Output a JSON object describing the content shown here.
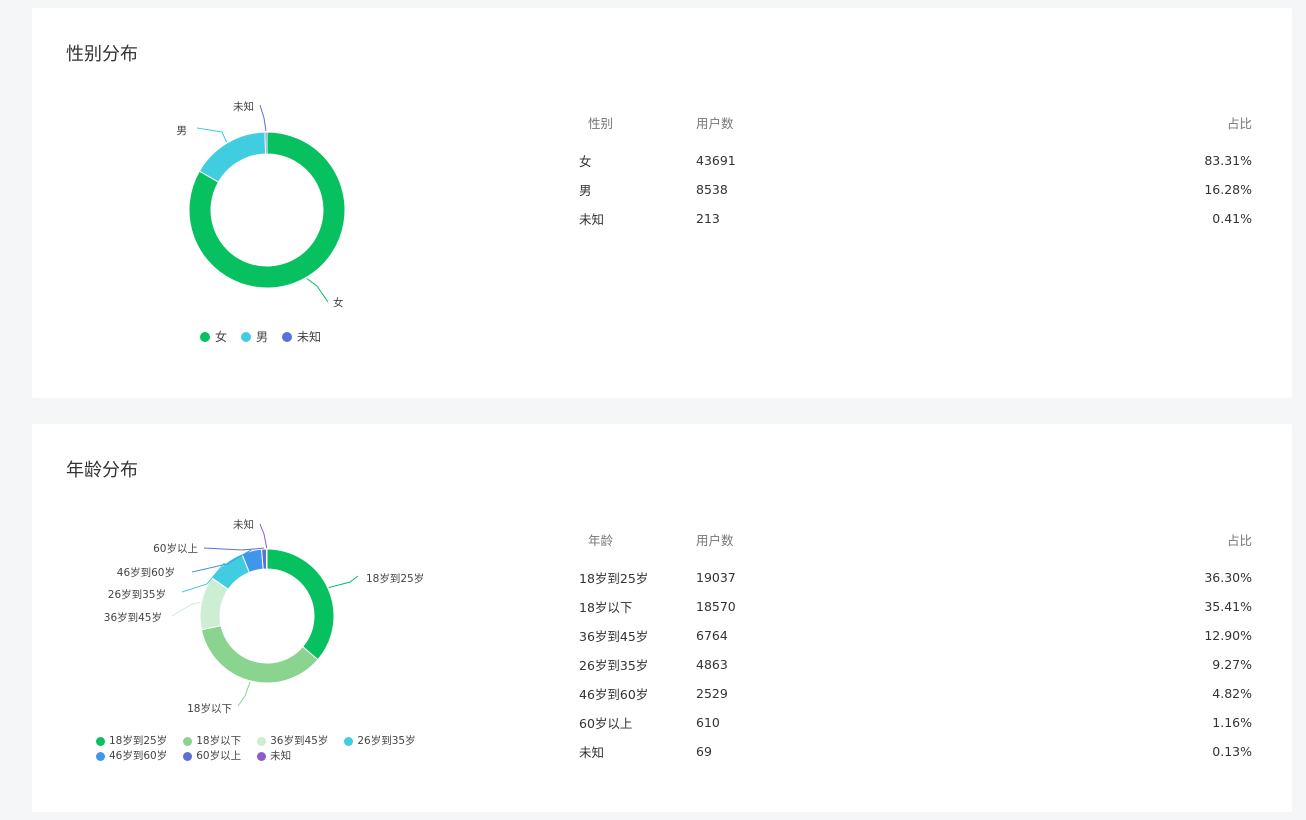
{
  "gender_section": {
    "title": "性别分布",
    "table": {
      "headers": [
        "性别",
        "用户数",
        "占比"
      ],
      "rows": [
        {
          "label": "女",
          "count": "43691",
          "percent": "83.31%"
        },
        {
          "label": "男",
          "count": "8538",
          "percent": "16.28%"
        },
        {
          "label": "未知",
          "count": "213",
          "percent": "0.41%"
        }
      ]
    }
  },
  "age_section": {
    "title": "年龄分布",
    "table": {
      "headers": [
        "年龄",
        "用户数",
        "占比"
      ],
      "rows": [
        {
          "label": "18岁到25岁",
          "count": "19037",
          "percent": "36.30%"
        },
        {
          "label": "18岁以下",
          "count": "18570",
          "percent": "35.41%"
        },
        {
          "label": "36岁到45岁",
          "count": "6764",
          "percent": "12.90%"
        },
        {
          "label": "26岁到35岁",
          "count": "4863",
          "percent": "9.27%"
        },
        {
          "label": "46岁到60岁",
          "count": "2529",
          "percent": "4.82%"
        },
        {
          "label": "60岁以上",
          "count": "610",
          "percent": "1.16%"
        },
        {
          "label": "未知",
          "count": "69",
          "percent": "0.13%"
        }
      ]
    }
  },
  "chart_data": [
    {
      "type": "pie",
      "variant": "donut",
      "title": "性别分布",
      "categories": [
        "女",
        "男",
        "未知"
      ],
      "values": [
        43691,
        8538,
        213
      ],
      "colors": [
        "#07c160",
        "#40cde0",
        "#5b6fd6"
      ],
      "legend": "bottom"
    },
    {
      "type": "pie",
      "variant": "donut",
      "title": "年龄分布",
      "categories": [
        "18岁到25岁",
        "18岁以下",
        "36岁到45岁",
        "26岁到35岁",
        "46岁到60岁",
        "60岁以上",
        "未知"
      ],
      "values": [
        19037,
        18570,
        6764,
        4863,
        2529,
        610,
        69
      ],
      "colors": [
        "#07c160",
        "#8bd48f",
        "#cdeed2",
        "#40cde0",
        "#3f97ec",
        "#5b6fd6",
        "#8a5cd0"
      ],
      "legend": "bottom"
    }
  ]
}
